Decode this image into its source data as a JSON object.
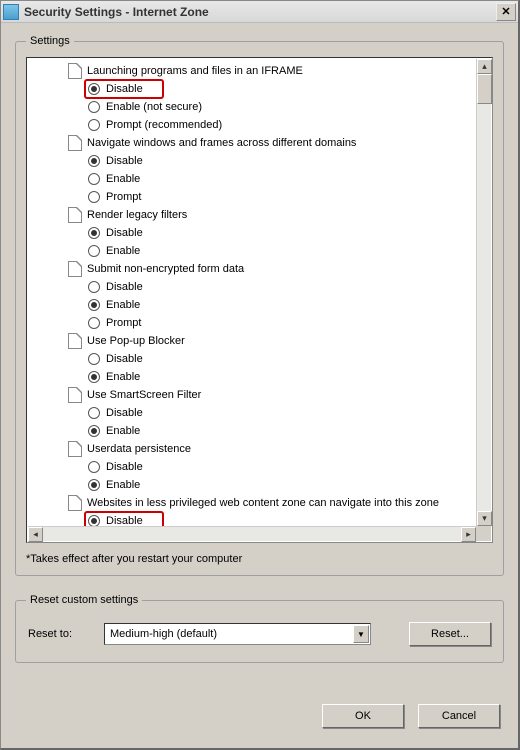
{
  "window": {
    "title": "Security Settings - Internet Zone"
  },
  "settings": {
    "legend": "Settings",
    "note": "*Takes effect after you restart your computer",
    "groups": [
      {
        "label": "Launching programs and files in an IFRAME",
        "options": [
          {
            "label": "Disable",
            "selected": true,
            "highlight": true
          },
          {
            "label": "Enable (not secure)",
            "selected": false
          },
          {
            "label": "Prompt (recommended)",
            "selected": false
          }
        ]
      },
      {
        "label": "Navigate windows and frames across different domains",
        "options": [
          {
            "label": "Disable",
            "selected": true
          },
          {
            "label": "Enable",
            "selected": false
          },
          {
            "label": "Prompt",
            "selected": false
          }
        ]
      },
      {
        "label": "Render legacy filters",
        "options": [
          {
            "label": "Disable",
            "selected": true
          },
          {
            "label": "Enable",
            "selected": false
          }
        ]
      },
      {
        "label": "Submit non-encrypted form data",
        "options": [
          {
            "label": "Disable",
            "selected": false
          },
          {
            "label": "Enable",
            "selected": true
          },
          {
            "label": "Prompt",
            "selected": false
          }
        ]
      },
      {
        "label": "Use Pop-up Blocker",
        "options": [
          {
            "label": "Disable",
            "selected": false
          },
          {
            "label": "Enable",
            "selected": true
          }
        ]
      },
      {
        "label": "Use SmartScreen Filter",
        "options": [
          {
            "label": "Disable",
            "selected": false
          },
          {
            "label": "Enable",
            "selected": true
          }
        ]
      },
      {
        "label": "Userdata persistence",
        "options": [
          {
            "label": "Disable",
            "selected": false
          },
          {
            "label": "Enable",
            "selected": true
          }
        ]
      },
      {
        "label": "Websites in less privileged web content zone can navigate into this zone",
        "options": [
          {
            "label": "Disable",
            "selected": true,
            "highlight": true
          }
        ]
      }
    ]
  },
  "reset": {
    "legend": "Reset custom settings",
    "label": "Reset to:",
    "selected": "Medium-high (default)",
    "button": "Reset..."
  },
  "buttons": {
    "ok": "OK",
    "cancel": "Cancel"
  }
}
